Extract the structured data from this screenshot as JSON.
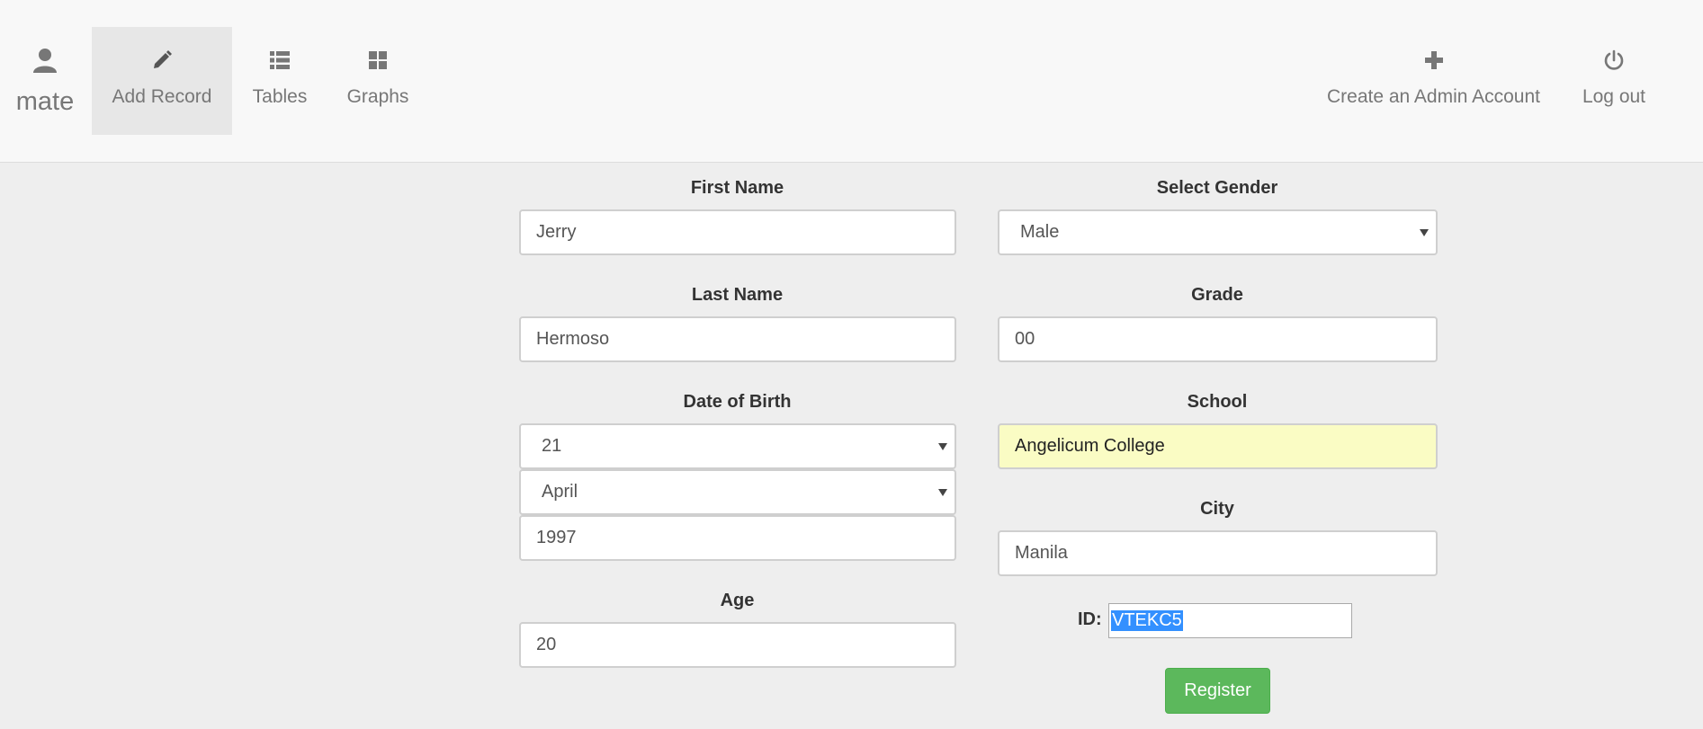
{
  "nav": {
    "brand": {
      "label": "mate",
      "icon": "user-icon"
    },
    "items": [
      {
        "label": "Add Record",
        "icon": "pencil-icon",
        "active": true
      },
      {
        "label": "Tables",
        "icon": "list-icon"
      },
      {
        "label": "Graphs",
        "icon": "grid-icon"
      }
    ],
    "right_items": [
      {
        "label": "Create an Admin Account",
        "icon": "plus-icon"
      },
      {
        "label": "Log out",
        "icon": "power-icon"
      }
    ]
  },
  "form": {
    "first_name": {
      "label": "First Name",
      "value": "Jerry"
    },
    "last_name": {
      "label": "Last Name",
      "value": "Hermoso"
    },
    "dob": {
      "label": "Date of Birth",
      "day": "21",
      "month": "April",
      "year": "1997"
    },
    "age": {
      "label": "Age",
      "value": "20"
    },
    "gender": {
      "label": "Select Gender",
      "value": "Male"
    },
    "grade": {
      "label": "Grade",
      "value": "00"
    },
    "school": {
      "label": "School",
      "value": "Angelicum College"
    },
    "city": {
      "label": "City",
      "value": "Manila"
    },
    "id": {
      "label": "ID:",
      "value": "VTEKC5"
    },
    "register_label": "Register"
  },
  "colors": {
    "navbar_bg": "#f8f8f8",
    "page_bg": "#eeeeee",
    "active_nav_bg": "#e7e7e7",
    "register_green": "#5cb85c",
    "autofill_yellow": "#fafcc4",
    "selection_blue": "#3390ff"
  }
}
